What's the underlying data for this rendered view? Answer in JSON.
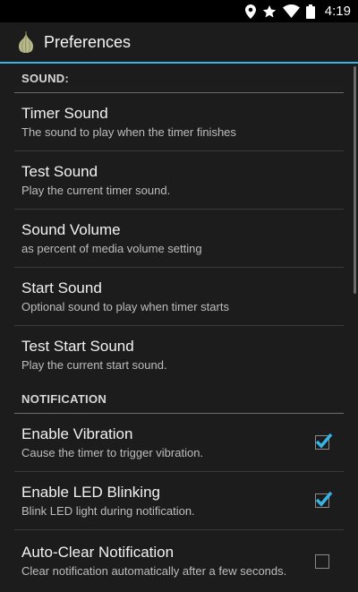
{
  "status_bar": {
    "time": "4:19",
    "icons": [
      "location-icon",
      "star-icon",
      "wifi-icon",
      "battery-icon"
    ]
  },
  "action_bar": {
    "title": "Preferences",
    "icon": "garlic-app-icon",
    "accent_color": "#33b5e5"
  },
  "sections": [
    {
      "header": "SOUND:",
      "items": [
        {
          "title": "Timer Sound",
          "summary": "The sound to play when the timer finishes"
        },
        {
          "title": "Test Sound",
          "summary": "Play the current timer sound."
        },
        {
          "title": "Sound Volume",
          "summary": "as percent of media volume setting"
        },
        {
          "title": "Start Sound",
          "summary": "Optional sound to play when timer starts"
        },
        {
          "title": "Test Start Sound",
          "summary": "Play the current start sound."
        }
      ]
    },
    {
      "header": "NOTIFICATION",
      "items": [
        {
          "title": "Enable Vibration",
          "summary": "Cause the timer to trigger vibration.",
          "checked": true
        },
        {
          "title": "Enable LED Blinking",
          "summary": "Blink LED light during notification.",
          "checked": true
        },
        {
          "title": "Auto-Clear Notification",
          "summary": "Clear notification automatically after a few seconds.",
          "checked": false
        }
      ]
    }
  ]
}
